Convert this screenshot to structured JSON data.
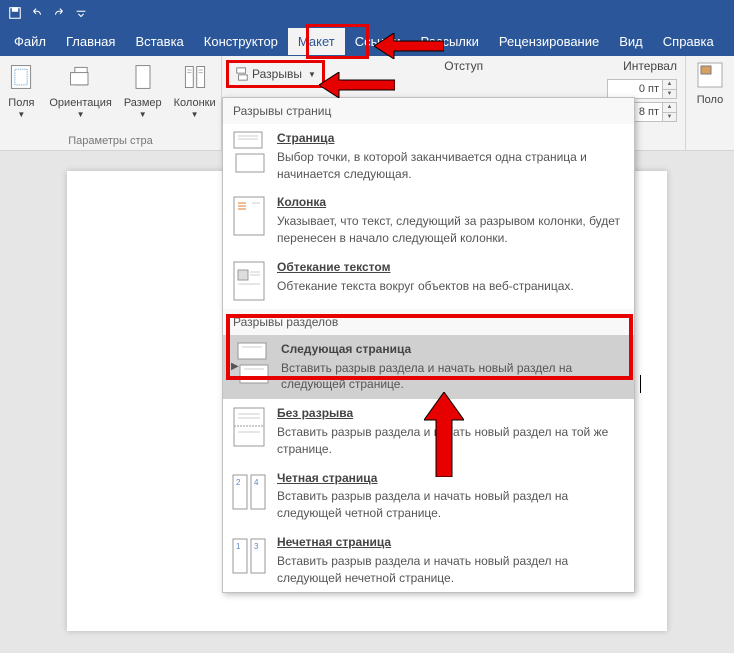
{
  "qat": {
    "save": "save",
    "undo": "undo",
    "redo": "redo"
  },
  "menu": {
    "file": "Файл",
    "home": "Главная",
    "insert": "Вставка",
    "design": "Конструктор",
    "layout": "Макет",
    "references": "Ссылки",
    "mailings": "Рассылки",
    "review": "Рецензирование",
    "view": "Вид",
    "help": "Справка"
  },
  "ribbon": {
    "fields": "Поля",
    "orientation": "Ориентация",
    "size": "Размер",
    "columns": "Колонки",
    "breaks": "Разрывы",
    "page_setup_title": "Параметры стра",
    "indent": "Отступ",
    "interval": "Интервал",
    "position": "Поло",
    "spin_before": "0 пт",
    "spin_after": "8 пт"
  },
  "dropdown": {
    "section1": "Разрывы страниц",
    "page": {
      "t": "Страница",
      "d": "Выбор точки, в которой заканчивается одна страница и начинается следующая."
    },
    "column": {
      "t": "Колонка",
      "d": "Указывает, что текст, следующий за разрывом колонки, будет перенесен в начало следующей колонки."
    },
    "wrap": {
      "t": "Обтекание текстом",
      "d": "Обтекание текста вокруг объектов на веб-страницах."
    },
    "section2": "Разрывы разделов",
    "nextpage": {
      "t": "Следующая страница",
      "d": "Вставить разрыв раздела и начать новый раздел на следующей странице."
    },
    "continuous": {
      "t": "Без разрыва",
      "d": "Вставить разрыв раздела и начать новый раздел на той же странице."
    },
    "evenpage": {
      "t": "Четная страница",
      "d": "Вставить разрыв раздела и начать новый раздел на следующей четной странице."
    },
    "oddpage": {
      "t": "Нечетная страница",
      "d": "Вставить разрыв раздела и начать новый раздел на следующей нечетной странице."
    }
  }
}
